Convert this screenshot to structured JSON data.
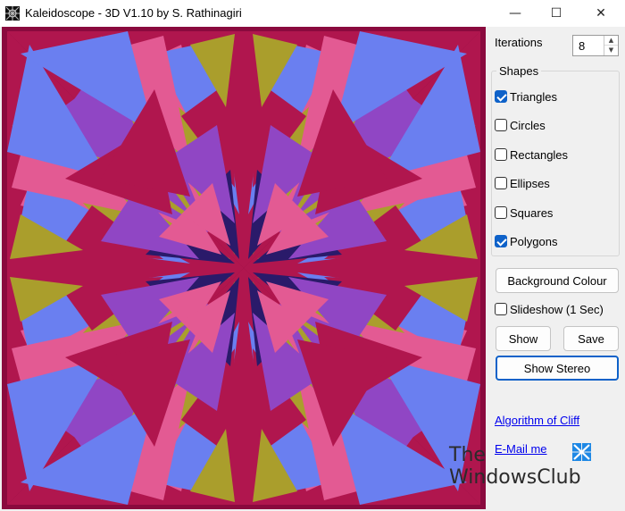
{
  "window": {
    "title": "Kaleidoscope - 3D V1.10 by S. Rathinagiri",
    "min_glyph": "—",
    "max_glyph": "☐",
    "close_glyph": "✕"
  },
  "controls": {
    "iterations_label": "Iterations",
    "iterations_value": "8",
    "spin_up": "▲",
    "spin_down": "▼",
    "shapes_title": "Shapes",
    "shapes": [
      {
        "label": "Triangles",
        "checked": true
      },
      {
        "label": "Circles",
        "checked": false
      },
      {
        "label": "Rectangles",
        "checked": false
      },
      {
        "label": "Ellipses",
        "checked": false
      },
      {
        "label": "Squares",
        "checked": false
      },
      {
        "label": "Polygons",
        "checked": true
      }
    ],
    "background_button": "Background Colour",
    "slideshow_label": "Slideshow (1 Sec)",
    "slideshow_checked": false,
    "show_button": "Show",
    "save_button": "Save",
    "stereo_button": "Show Stereo",
    "algorithm_link": "Algorithm of Cliff",
    "email_link": "E-Mail me"
  },
  "watermark": {
    "line1": "The",
    "line2": "WindowsClub"
  },
  "colors": {
    "background": "#8a0a3e",
    "crimson": "#b0164e",
    "olive": "#aa9e2c",
    "blue": "#6a7ff0",
    "pink": "#e35a93",
    "purple": "#9046c4",
    "navy": "#2a1a6a",
    "accent": "#0f62c9"
  }
}
